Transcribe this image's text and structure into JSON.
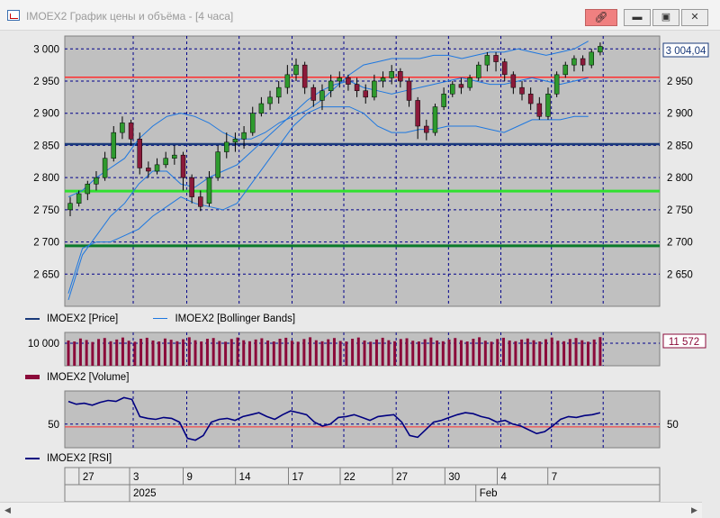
{
  "window": {
    "title": "IMOEX2 График цены и объёма - [4 часа]",
    "link_icon": "link-icon",
    "buttons": [
      "minimize-button",
      "restore-button",
      "close-button"
    ]
  },
  "legends": {
    "price": "IMOEX2 [Price]",
    "bollinger": "IMOEX2 [Bollinger Bands]",
    "volume": "IMOEX2 [Volume]",
    "rsi": "IMOEX2 [RSI]"
  },
  "colors": {
    "up": "#2e9a2e",
    "down": "#8b1a3a",
    "bollinger": "#1e78e0",
    "rsi": "#000080",
    "volume": "#8b0a3a",
    "price_line": "#1a3a7a",
    "red_line": "#ff3030",
    "green_line": "#30e030",
    "dark_green_line": "#0a7a2a"
  },
  "chart_data": [
    {
      "type": "candlestick",
      "name": "price",
      "ylim": [
        2600,
        3020
      ],
      "yticks": [
        "3 000",
        "2 950",
        "2 900",
        "2 850",
        "2 800",
        "2 750",
        "2 700",
        "2 650"
      ],
      "yticks_right": [
        "2 950",
        "2 900",
        "2 850",
        "2 800",
        "2 750",
        "2 700",
        "2 650"
      ],
      "last_value": "3 004,04",
      "horizontal_levels": [
        {
          "value": 2956,
          "color": "red"
        },
        {
          "value": 2852,
          "color": "dark-blue"
        },
        {
          "value": 2779,
          "color": "green"
        },
        {
          "value": 2694,
          "color": "dark-green"
        }
      ],
      "bollinger_upper": [
        2770,
        2780,
        2800,
        2815,
        2830,
        2860,
        2880,
        2895,
        2900,
        2895,
        2885,
        2870,
        2860,
        2860,
        2870,
        2885,
        2895,
        2905,
        2920,
        2940,
        2960,
        2975,
        2980,
        2985,
        2985,
        2985,
        2990,
        2990,
        2985,
        2990,
        2995,
        2995,
        3000,
        2995,
        2990,
        2995,
        3000,
        3012
      ],
      "bollinger_middle": [
        2610,
        2680,
        2710,
        2740,
        2760,
        2790,
        2810,
        2810,
        2790,
        2785,
        2800,
        2810,
        2820,
        2840,
        2860,
        2880,
        2900,
        2920,
        2935,
        2945,
        2950,
        2940,
        2935,
        2930,
        2935,
        2940,
        2945,
        2950,
        2955,
        2950,
        2945,
        2945,
        2950,
        2955,
        2950,
        2945,
        2950,
        2955
      ],
      "bollinger_lower": [
        2620,
        2690,
        2700,
        2700,
        2710,
        2720,
        2740,
        2755,
        2770,
        2760,
        2755,
        2750,
        2760,
        2790,
        2820,
        2850,
        2880,
        2900,
        2910,
        2910,
        2910,
        2900,
        2880,
        2870,
        2870,
        2875,
        2875,
        2880,
        2880,
        2880,
        2875,
        2870,
        2880,
        2890,
        2890,
        2890,
        2895,
        2895
      ],
      "candles": [
        [
          2750,
          2760,
          2740,
          2770
        ],
        [
          2760,
          2775,
          2755,
          2780
        ],
        [
          2775,
          2790,
          2765,
          2795
        ],
        [
          2790,
          2800,
          2780,
          2810
        ],
        [
          2800,
          2830,
          2795,
          2840
        ],
        [
          2830,
          2870,
          2825,
          2880
        ],
        [
          2870,
          2885,
          2860,
          2895
        ],
        [
          2885,
          2860,
          2850,
          2890
        ],
        [
          2860,
          2815,
          2805,
          2870
        ],
        [
          2815,
          2810,
          2800,
          2825
        ],
        [
          2810,
          2820,
          2805,
          2830
        ],
        [
          2820,
          2830,
          2815,
          2840
        ],
        [
          2830,
          2835,
          2820,
          2850
        ],
        [
          2835,
          2800,
          2780,
          2840
        ],
        [
          2800,
          2770,
          2760,
          2805
        ],
        [
          2770,
          2755,
          2748,
          2780
        ],
        [
          2760,
          2800,
          2755,
          2810
        ],
        [
          2800,
          2840,
          2795,
          2850
        ],
        [
          2840,
          2855,
          2830,
          2870
        ],
        [
          2855,
          2860,
          2840,
          2870
        ],
        [
          2860,
          2870,
          2845,
          2880
        ],
        [
          2870,
          2900,
          2865,
          2910
        ],
        [
          2900,
          2915,
          2895,
          2925
        ],
        [
          2915,
          2925,
          2905,
          2935
        ],
        [
          2925,
          2940,
          2915,
          2950
        ],
        [
          2940,
          2960,
          2930,
          2975
        ],
        [
          2960,
          2975,
          2950,
          2985
        ],
        [
          2975,
          2940,
          2930,
          2980
        ],
        [
          2940,
          2920,
          2910,
          2945
        ],
        [
          2920,
          2935,
          2905,
          2945
        ],
        [
          2935,
          2950,
          2925,
          2960
        ],
        [
          2950,
          2955,
          2940,
          2965
        ],
        [
          2955,
          2945,
          2935,
          2960
        ],
        [
          2945,
          2935,
          2925,
          2955
        ],
        [
          2935,
          2925,
          2915,
          2945
        ],
        [
          2925,
          2950,
          2920,
          2960
        ],
        [
          2950,
          2955,
          2940,
          2965
        ],
        [
          2955,
          2965,
          2945,
          2975
        ],
        [
          2965,
          2950,
          2940,
          2970
        ],
        [
          2950,
          2920,
          2910,
          2955
        ],
        [
          2920,
          2880,
          2860,
          2925
        ],
        [
          2880,
          2870,
          2858,
          2890
        ],
        [
          2870,
          2910,
          2865,
          2915
        ],
        [
          2910,
          2930,
          2905,
          2940
        ],
        [
          2930,
          2945,
          2925,
          2950
        ],
        [
          2945,
          2940,
          2930,
          2955
        ],
        [
          2940,
          2955,
          2935,
          2960
        ],
        [
          2955,
          2975,
          2950,
          2980
        ],
        [
          2975,
          2990,
          2965,
          2995
        ],
        [
          2990,
          2980,
          2965,
          2995
        ],
        [
          2980,
          2960,
          2950,
          2985
        ],
        [
          2960,
          2940,
          2930,
          2965
        ],
        [
          2940,
          2930,
          2920,
          2950
        ],
        [
          2930,
          2915,
          2905,
          2940
        ],
        [
          2915,
          2895,
          2890,
          2925
        ],
        [
          2895,
          2930,
          2890,
          2940
        ],
        [
          2930,
          2960,
          2925,
          2965
        ],
        [
          2960,
          2975,
          2955,
          2980
        ],
        [
          2975,
          2985,
          2965,
          2990
        ],
        [
          2985,
          2975,
          2965,
          2990
        ],
        [
          2975,
          2995,
          2970,
          3000
        ],
        [
          2995,
          3004,
          2990,
          3010
        ]
      ]
    },
    {
      "type": "bar",
      "name": "volume",
      "ytick": "10 000",
      "last_value": "11 572",
      "values": [
        10200,
        9800,
        11000,
        10400,
        9600,
        10800,
        11200,
        9900,
        10600,
        11400,
        10100,
        9700,
        10900,
        11300,
        10200,
        9800,
        11000,
        10500,
        9900,
        10700,
        11500,
        10300,
        9800,
        10900,
        11200,
        10000,
        9700,
        10800,
        11400,
        10300,
        9900,
        10600,
        11100,
        10200,
        9800,
        10900,
        11300,
        10100,
        9700,
        10800,
        11500,
        10300,
        9900,
        10700,
        11200,
        10000,
        9800,
        10900,
        11400,
        10200,
        9700,
        10600,
        11300,
        10300,
        9900,
        10800,
        11100,
        10100,
        9800,
        10700,
        11400,
        10200,
        9900,
        10600,
        11200,
        10300,
        9800,
        10900,
        11500,
        10100,
        9700,
        10800,
        11300,
        10200,
        9900,
        10600,
        11000,
        10300,
        9800,
        10700,
        11400,
        10100,
        9900,
        10800,
        11200,
        10300,
        9700,
        10600,
        11572
      ]
    },
    {
      "type": "line",
      "name": "rsi",
      "ytick": "50",
      "reference": 47,
      "values": [
        74,
        71,
        72,
        70,
        73,
        75,
        74,
        78,
        76,
        58,
        56,
        55,
        57,
        56,
        52,
        35,
        33,
        38,
        52,
        55,
        56,
        54,
        58,
        60,
        62,
        58,
        55,
        60,
        64,
        62,
        60,
        52,
        48,
        50,
        57,
        58,
        60,
        57,
        54,
        58,
        59,
        60,
        52,
        38,
        36,
        44,
        52,
        54,
        57,
        60,
        62,
        61,
        58,
        56,
        52,
        54,
        50,
        48,
        44,
        40,
        42,
        48,
        55,
        58,
        57,
        59,
        60,
        62
      ],
      "ylim": [
        0,
        100
      ]
    }
  ],
  "xaxis": {
    "days": [
      {
        "label": "27",
        "pos": 0.03
      },
      {
        "label": "3",
        "pos": 0.115
      },
      {
        "label": "9",
        "pos": 0.205
      },
      {
        "label": "14",
        "pos": 0.293
      },
      {
        "label": "17",
        "pos": 0.382
      },
      {
        "label": "22",
        "pos": 0.469
      },
      {
        "label": "27",
        "pos": 0.557
      },
      {
        "label": "30",
        "pos": 0.645
      },
      {
        "label": "4",
        "pos": 0.733
      },
      {
        "label": "7",
        "pos": 0.818
      }
    ],
    "years": [
      {
        "label": "2025",
        "pos": 0.115
      },
      {
        "label": "Feb",
        "pos": 0.697
      }
    ]
  }
}
